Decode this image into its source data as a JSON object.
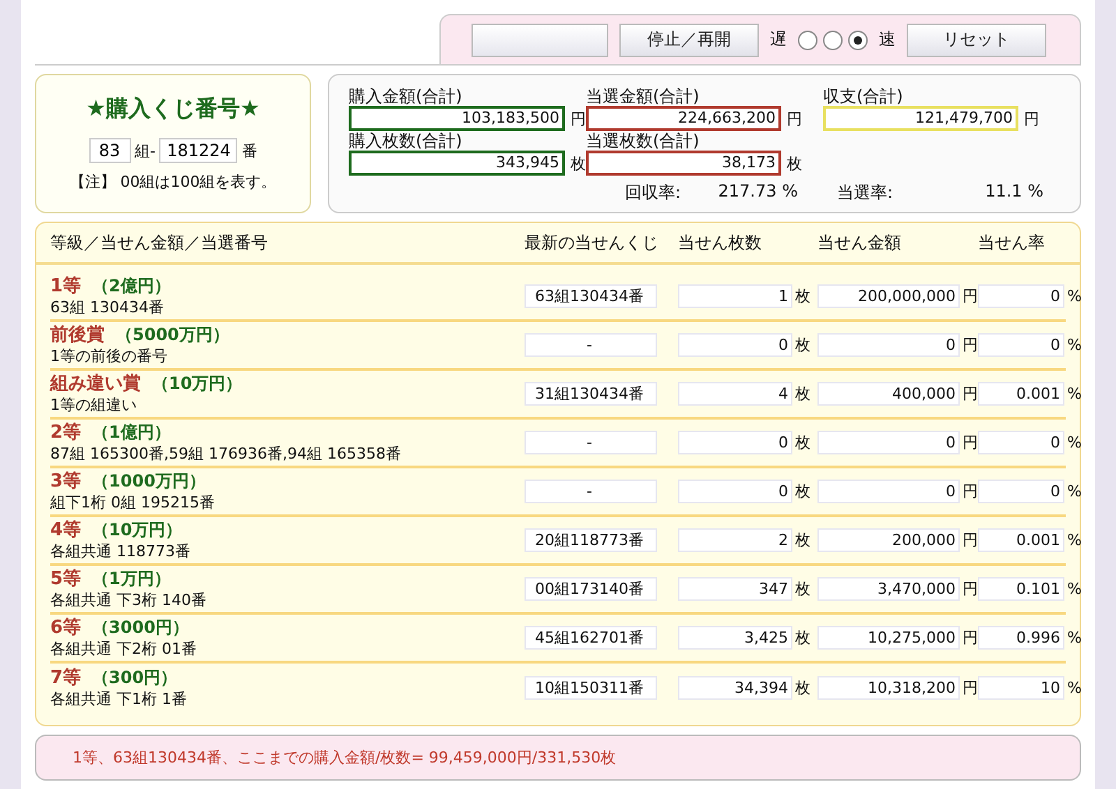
{
  "controls": {
    "buttons": [
      "停止／再開",
      "リセット"
    ],
    "speed": {
      "slow_label": "遅",
      "fast_label": "速",
      "options": [
        {
          "selected": false
        },
        {
          "selected": false
        },
        {
          "selected": true
        }
      ]
    }
  },
  "ticket": {
    "title": "★購入くじ番号★",
    "group": "83",
    "group_suffix": "組-",
    "number": "181224",
    "number_suffix": "番",
    "note": "【注】 00組は100組を表す。"
  },
  "totals": {
    "fields": [
      {
        "label": "購入金額(合計)",
        "value": "103,183,500",
        "unit": "円",
        "color": "#1e6b1e"
      },
      {
        "label": "当選金額(合計)",
        "value": "224,663,200",
        "unit": "円",
        "color": "#b03a2e"
      },
      {
        "label": "収支(合計)",
        "value": "121,479,700",
        "unit": "円",
        "color": "#e8e060"
      },
      {
        "label": "購入枚数(合計)",
        "value": "343,945",
        "unit": "枚",
        "color": "#1e6b1e"
      },
      {
        "label": "当選枚数(合計)",
        "value": "38,173",
        "unit": "枚",
        "color": "#b03a2e"
      }
    ],
    "rates": [
      {
        "label": "回収率:",
        "value": "217.73 %"
      },
      {
        "label": "当選率:",
        "value": "11.1 %"
      }
    ]
  },
  "table": {
    "columns": [
      "等級／当せん金額／当選番号",
      "最新の当せんくじ",
      "当せん枚数",
      "当せん金額",
      "当せん率"
    ],
    "rows": [
      {
        "grade": "1等",
        "prize": "（2億円）",
        "numbers": "63組 130434番",
        "latest": "63組130434番",
        "count": "1",
        "count_unit": "枚",
        "amount": "200,000,000",
        "amount_unit": "円",
        "rate": "0",
        "rate_unit": "%"
      },
      {
        "grade": "前後賞",
        "prize": "（5000万円）",
        "numbers": "1等の前後の番号",
        "latest": "-",
        "count": "0",
        "count_unit": "枚",
        "amount": "0",
        "amount_unit": "円",
        "rate": "0",
        "rate_unit": "%"
      },
      {
        "grade": "組み違い賞",
        "prize": "（10万円）",
        "numbers": "1等の組違い",
        "latest": "31組130434番",
        "count": "4",
        "count_unit": "枚",
        "amount": "400,000",
        "amount_unit": "円",
        "rate": "0.001",
        "rate_unit": "%"
      },
      {
        "grade": "2等",
        "prize": "（1億円）",
        "numbers": "87組 165300番,59組 176936番,94組 165358番",
        "latest": "-",
        "count": "0",
        "count_unit": "枚",
        "amount": "0",
        "amount_unit": "円",
        "rate": "0",
        "rate_unit": "%"
      },
      {
        "grade": "3等",
        "prize": "（1000万円）",
        "numbers": "組下1桁 0組 195215番",
        "latest": "-",
        "count": "0",
        "count_unit": "枚",
        "amount": "0",
        "amount_unit": "円",
        "rate": "0",
        "rate_unit": "%"
      },
      {
        "grade": "4等",
        "prize": "（10万円）",
        "numbers": "各組共通 118773番",
        "latest": "20組118773番",
        "count": "2",
        "count_unit": "枚",
        "amount": "200,000",
        "amount_unit": "円",
        "rate": "0.001",
        "rate_unit": "%"
      },
      {
        "grade": "5等",
        "prize": "（1万円）",
        "numbers": "各組共通 下3桁 140番",
        "latest": "00組173140番",
        "count": "347",
        "count_unit": "枚",
        "amount": "3,470,000",
        "amount_unit": "円",
        "rate": "0.101",
        "rate_unit": "%"
      },
      {
        "grade": "6等",
        "prize": "（3000円）",
        "numbers": "各組共通 下2桁 01番",
        "latest": "45組162701番",
        "count": "3,425",
        "count_unit": "枚",
        "amount": "10,275,000",
        "amount_unit": "円",
        "rate": "0.996",
        "rate_unit": "%"
      },
      {
        "grade": "7等",
        "prize": "（300円）",
        "numbers": "各組共通 下1桁 1番",
        "latest": "10組150311番",
        "count": "34,394",
        "count_unit": "枚",
        "amount": "10,318,200",
        "amount_unit": "円",
        "rate": "10",
        "rate_unit": "%"
      }
    ]
  },
  "footer": {
    "message": "1等、63組130434番、ここまでの購入金額/枚数= 99,459,000円/331,530枚"
  }
}
